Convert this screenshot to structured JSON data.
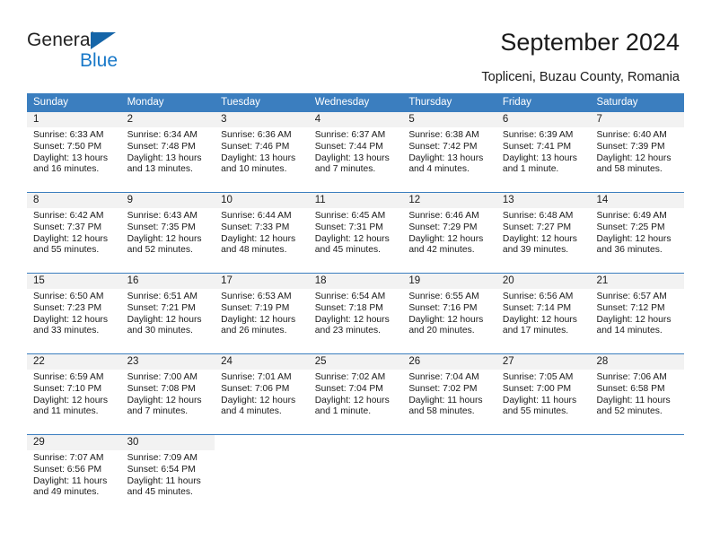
{
  "logo": {
    "word1": "General",
    "word2": "Blue",
    "triangle_color": "#1565a8",
    "blue_color": "#1878c8"
  },
  "header": {
    "title": "September 2024",
    "subtitle": "Topliceni, Buzau County, Romania"
  },
  "theme": {
    "header_bg": "#3b7ebf",
    "header_text": "#ffffff",
    "daynum_band": "#f2f2f2",
    "row_divider": "#3b7ebf"
  },
  "weekdays": [
    "Sunday",
    "Monday",
    "Tuesday",
    "Wednesday",
    "Thursday",
    "Friday",
    "Saturday"
  ],
  "weeks": [
    [
      {
        "day": "1",
        "sunrise": "Sunrise: 6:33 AM",
        "sunset": "Sunset: 7:50 PM",
        "daylight": "Daylight: 13 hours and 16 minutes."
      },
      {
        "day": "2",
        "sunrise": "Sunrise: 6:34 AM",
        "sunset": "Sunset: 7:48 PM",
        "daylight": "Daylight: 13 hours and 13 minutes."
      },
      {
        "day": "3",
        "sunrise": "Sunrise: 6:36 AM",
        "sunset": "Sunset: 7:46 PM",
        "daylight": "Daylight: 13 hours and 10 minutes."
      },
      {
        "day": "4",
        "sunrise": "Sunrise: 6:37 AM",
        "sunset": "Sunset: 7:44 PM",
        "daylight": "Daylight: 13 hours and 7 minutes."
      },
      {
        "day": "5",
        "sunrise": "Sunrise: 6:38 AM",
        "sunset": "Sunset: 7:42 PM",
        "daylight": "Daylight: 13 hours and 4 minutes."
      },
      {
        "day": "6",
        "sunrise": "Sunrise: 6:39 AM",
        "sunset": "Sunset: 7:41 PM",
        "daylight": "Daylight: 13 hours and 1 minute."
      },
      {
        "day": "7",
        "sunrise": "Sunrise: 6:40 AM",
        "sunset": "Sunset: 7:39 PM",
        "daylight": "Daylight: 12 hours and 58 minutes."
      }
    ],
    [
      {
        "day": "8",
        "sunrise": "Sunrise: 6:42 AM",
        "sunset": "Sunset: 7:37 PM",
        "daylight": "Daylight: 12 hours and 55 minutes."
      },
      {
        "day": "9",
        "sunrise": "Sunrise: 6:43 AM",
        "sunset": "Sunset: 7:35 PM",
        "daylight": "Daylight: 12 hours and 52 minutes."
      },
      {
        "day": "10",
        "sunrise": "Sunrise: 6:44 AM",
        "sunset": "Sunset: 7:33 PM",
        "daylight": "Daylight: 12 hours and 48 minutes."
      },
      {
        "day": "11",
        "sunrise": "Sunrise: 6:45 AM",
        "sunset": "Sunset: 7:31 PM",
        "daylight": "Daylight: 12 hours and 45 minutes."
      },
      {
        "day": "12",
        "sunrise": "Sunrise: 6:46 AM",
        "sunset": "Sunset: 7:29 PM",
        "daylight": "Daylight: 12 hours and 42 minutes."
      },
      {
        "day": "13",
        "sunrise": "Sunrise: 6:48 AM",
        "sunset": "Sunset: 7:27 PM",
        "daylight": "Daylight: 12 hours and 39 minutes."
      },
      {
        "day": "14",
        "sunrise": "Sunrise: 6:49 AM",
        "sunset": "Sunset: 7:25 PM",
        "daylight": "Daylight: 12 hours and 36 minutes."
      }
    ],
    [
      {
        "day": "15",
        "sunrise": "Sunrise: 6:50 AM",
        "sunset": "Sunset: 7:23 PM",
        "daylight": "Daylight: 12 hours and 33 minutes."
      },
      {
        "day": "16",
        "sunrise": "Sunrise: 6:51 AM",
        "sunset": "Sunset: 7:21 PM",
        "daylight": "Daylight: 12 hours and 30 minutes."
      },
      {
        "day": "17",
        "sunrise": "Sunrise: 6:53 AM",
        "sunset": "Sunset: 7:19 PM",
        "daylight": "Daylight: 12 hours and 26 minutes."
      },
      {
        "day": "18",
        "sunrise": "Sunrise: 6:54 AM",
        "sunset": "Sunset: 7:18 PM",
        "daylight": "Daylight: 12 hours and 23 minutes."
      },
      {
        "day": "19",
        "sunrise": "Sunrise: 6:55 AM",
        "sunset": "Sunset: 7:16 PM",
        "daylight": "Daylight: 12 hours and 20 minutes."
      },
      {
        "day": "20",
        "sunrise": "Sunrise: 6:56 AM",
        "sunset": "Sunset: 7:14 PM",
        "daylight": "Daylight: 12 hours and 17 minutes."
      },
      {
        "day": "21",
        "sunrise": "Sunrise: 6:57 AM",
        "sunset": "Sunset: 7:12 PM",
        "daylight": "Daylight: 12 hours and 14 minutes."
      }
    ],
    [
      {
        "day": "22",
        "sunrise": "Sunrise: 6:59 AM",
        "sunset": "Sunset: 7:10 PM",
        "daylight": "Daylight: 12 hours and 11 minutes."
      },
      {
        "day": "23",
        "sunrise": "Sunrise: 7:00 AM",
        "sunset": "Sunset: 7:08 PM",
        "daylight": "Daylight: 12 hours and 7 minutes."
      },
      {
        "day": "24",
        "sunrise": "Sunrise: 7:01 AM",
        "sunset": "Sunset: 7:06 PM",
        "daylight": "Daylight: 12 hours and 4 minutes."
      },
      {
        "day": "25",
        "sunrise": "Sunrise: 7:02 AM",
        "sunset": "Sunset: 7:04 PM",
        "daylight": "Daylight: 12 hours and 1 minute."
      },
      {
        "day": "26",
        "sunrise": "Sunrise: 7:04 AM",
        "sunset": "Sunset: 7:02 PM",
        "daylight": "Daylight: 11 hours and 58 minutes."
      },
      {
        "day": "27",
        "sunrise": "Sunrise: 7:05 AM",
        "sunset": "Sunset: 7:00 PM",
        "daylight": "Daylight: 11 hours and 55 minutes."
      },
      {
        "day": "28",
        "sunrise": "Sunrise: 7:06 AM",
        "sunset": "Sunset: 6:58 PM",
        "daylight": "Daylight: 11 hours and 52 minutes."
      }
    ],
    [
      {
        "day": "29",
        "sunrise": "Sunrise: 7:07 AM",
        "sunset": "Sunset: 6:56 PM",
        "daylight": "Daylight: 11 hours and 49 minutes."
      },
      {
        "day": "30",
        "sunrise": "Sunrise: 7:09 AM",
        "sunset": "Sunset: 6:54 PM",
        "daylight": "Daylight: 11 hours and 45 minutes."
      },
      {
        "day": "",
        "sunrise": "",
        "sunset": "",
        "daylight": ""
      },
      {
        "day": "",
        "sunrise": "",
        "sunset": "",
        "daylight": ""
      },
      {
        "day": "",
        "sunrise": "",
        "sunset": "",
        "daylight": ""
      },
      {
        "day": "",
        "sunrise": "",
        "sunset": "",
        "daylight": ""
      },
      {
        "day": "",
        "sunrise": "",
        "sunset": "",
        "daylight": ""
      }
    ]
  ]
}
